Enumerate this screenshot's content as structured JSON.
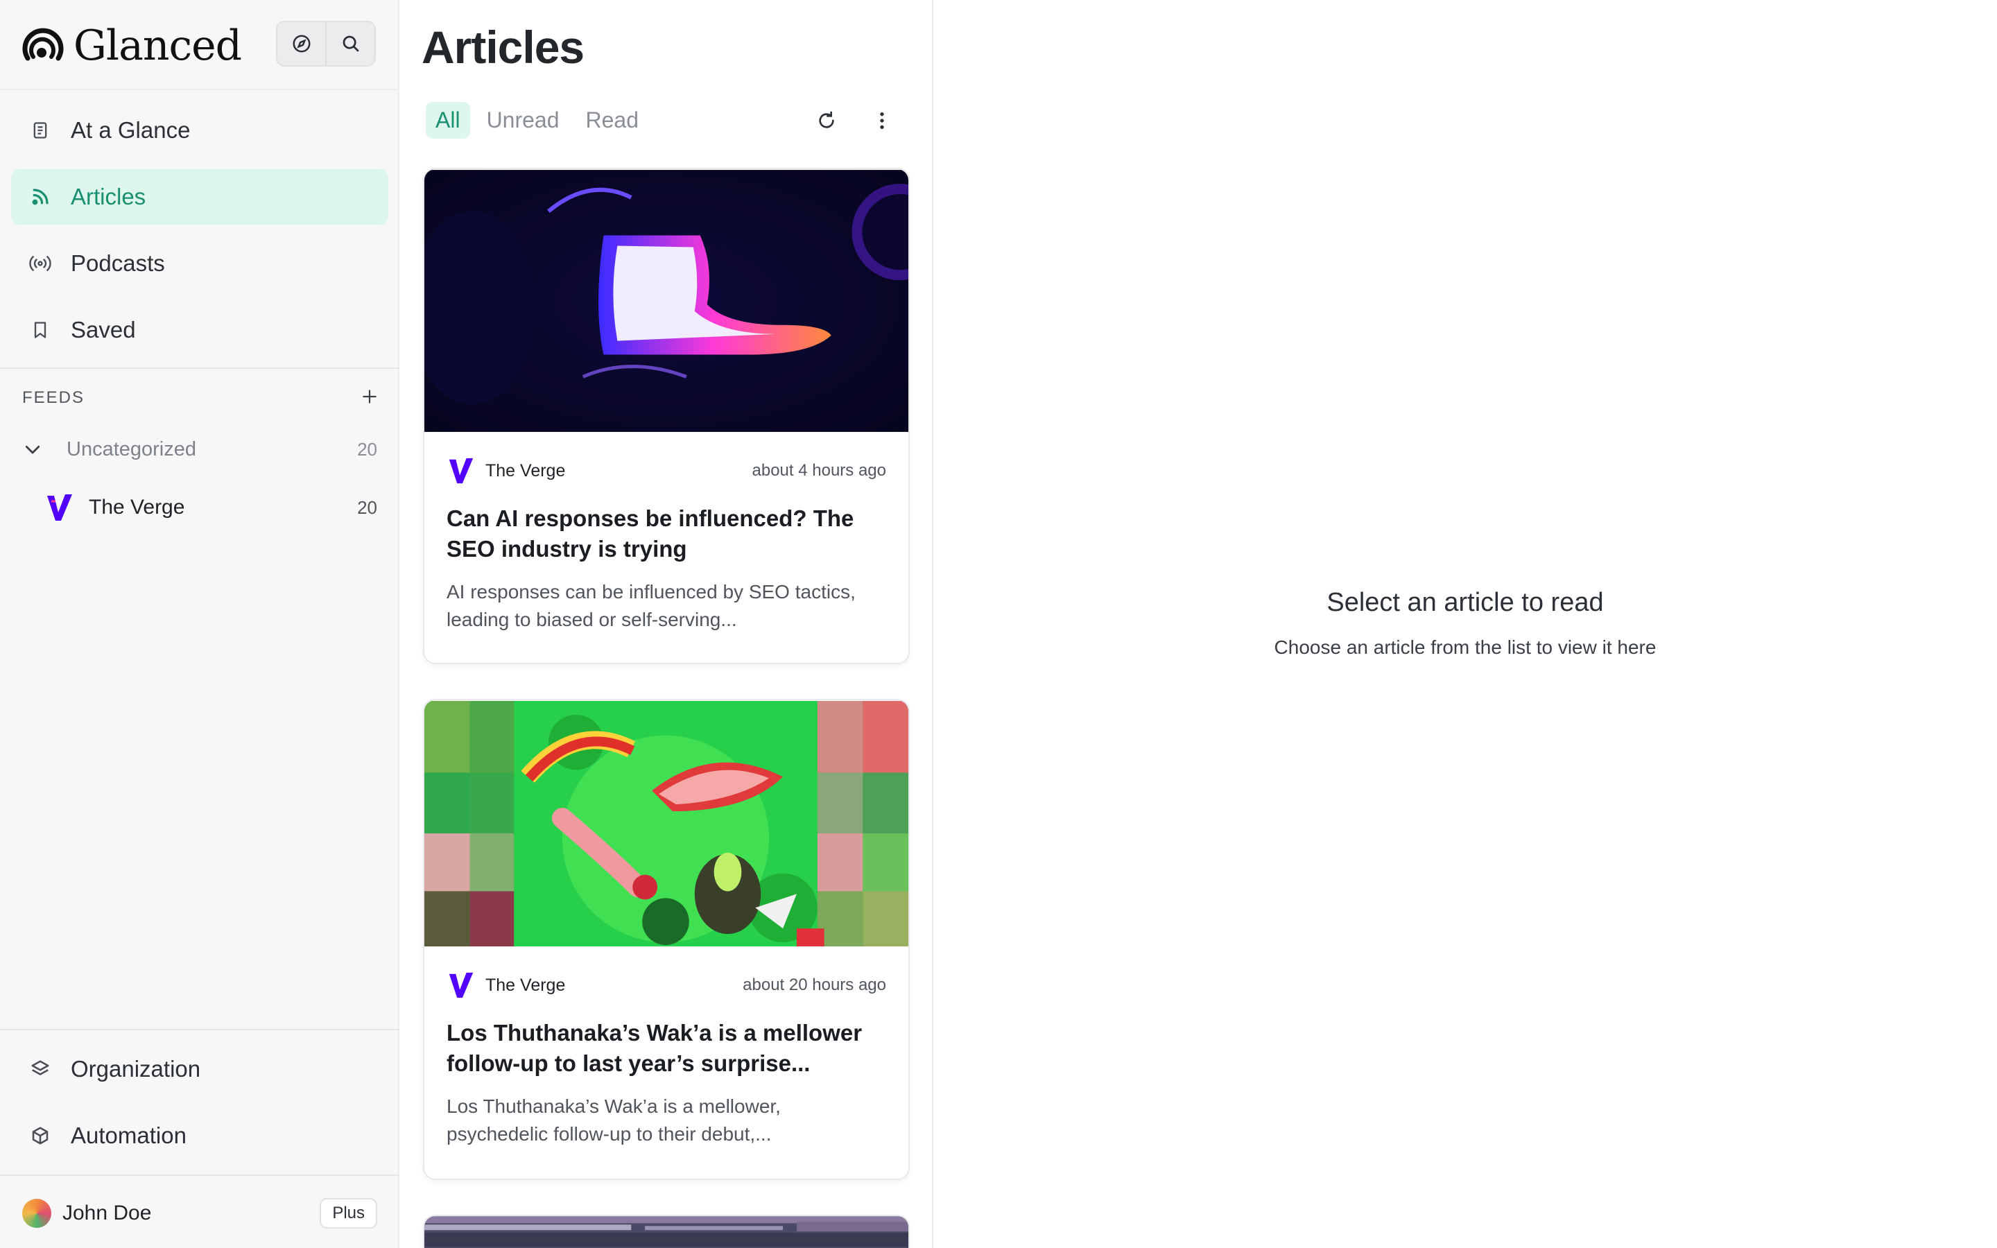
{
  "app": {
    "name": "Glanced"
  },
  "sidebar": {
    "nav": [
      {
        "label": "At a Glance",
        "icon": "document-icon"
      },
      {
        "label": "Articles",
        "icon": "rss-icon",
        "active": true
      },
      {
        "label": "Podcasts",
        "icon": "broadcast-icon"
      },
      {
        "label": "Saved",
        "icon": "bookmark-icon"
      }
    ],
    "feeds_label": "FEEDS",
    "category": {
      "label": "Uncategorized",
      "count": "20"
    },
    "feed": {
      "label": "The Verge",
      "count": "20"
    },
    "bottom": [
      {
        "label": "Organization",
        "icon": "layers-icon"
      },
      {
        "label": "Automation",
        "icon": "cube-icon"
      }
    ],
    "user": {
      "name": "John Doe",
      "plan": "Plus"
    }
  },
  "articles": {
    "title": "Articles",
    "tabs": [
      "All",
      "Unread",
      "Read"
    ],
    "active_tab": "All",
    "items": [
      {
        "source": "The Verge",
        "time": "about 4 hours ago",
        "title": "Can AI responses be influenced? The SEO industry is trying",
        "summary": "AI responses can be influenced by SEO tactics, leading to biased or self-serving..."
      },
      {
        "source": "The Verge",
        "time": "about 20 hours ago",
        "title": "Los Thuthanaka’s Wak’a is a mellower follow-up to last year’s surprise...",
        "summary": "Los Thuthanaka’s Wak’a is a mellower, psychedelic follow-up to their debut,..."
      }
    ]
  },
  "reader": {
    "empty_title": "Select an article to read",
    "empty_subtitle": "Choose an article from the list to view it here"
  },
  "colors": {
    "accent": "#1a8f71",
    "accent_bg": "#ddf7ec",
    "verge": "#5200ff"
  }
}
